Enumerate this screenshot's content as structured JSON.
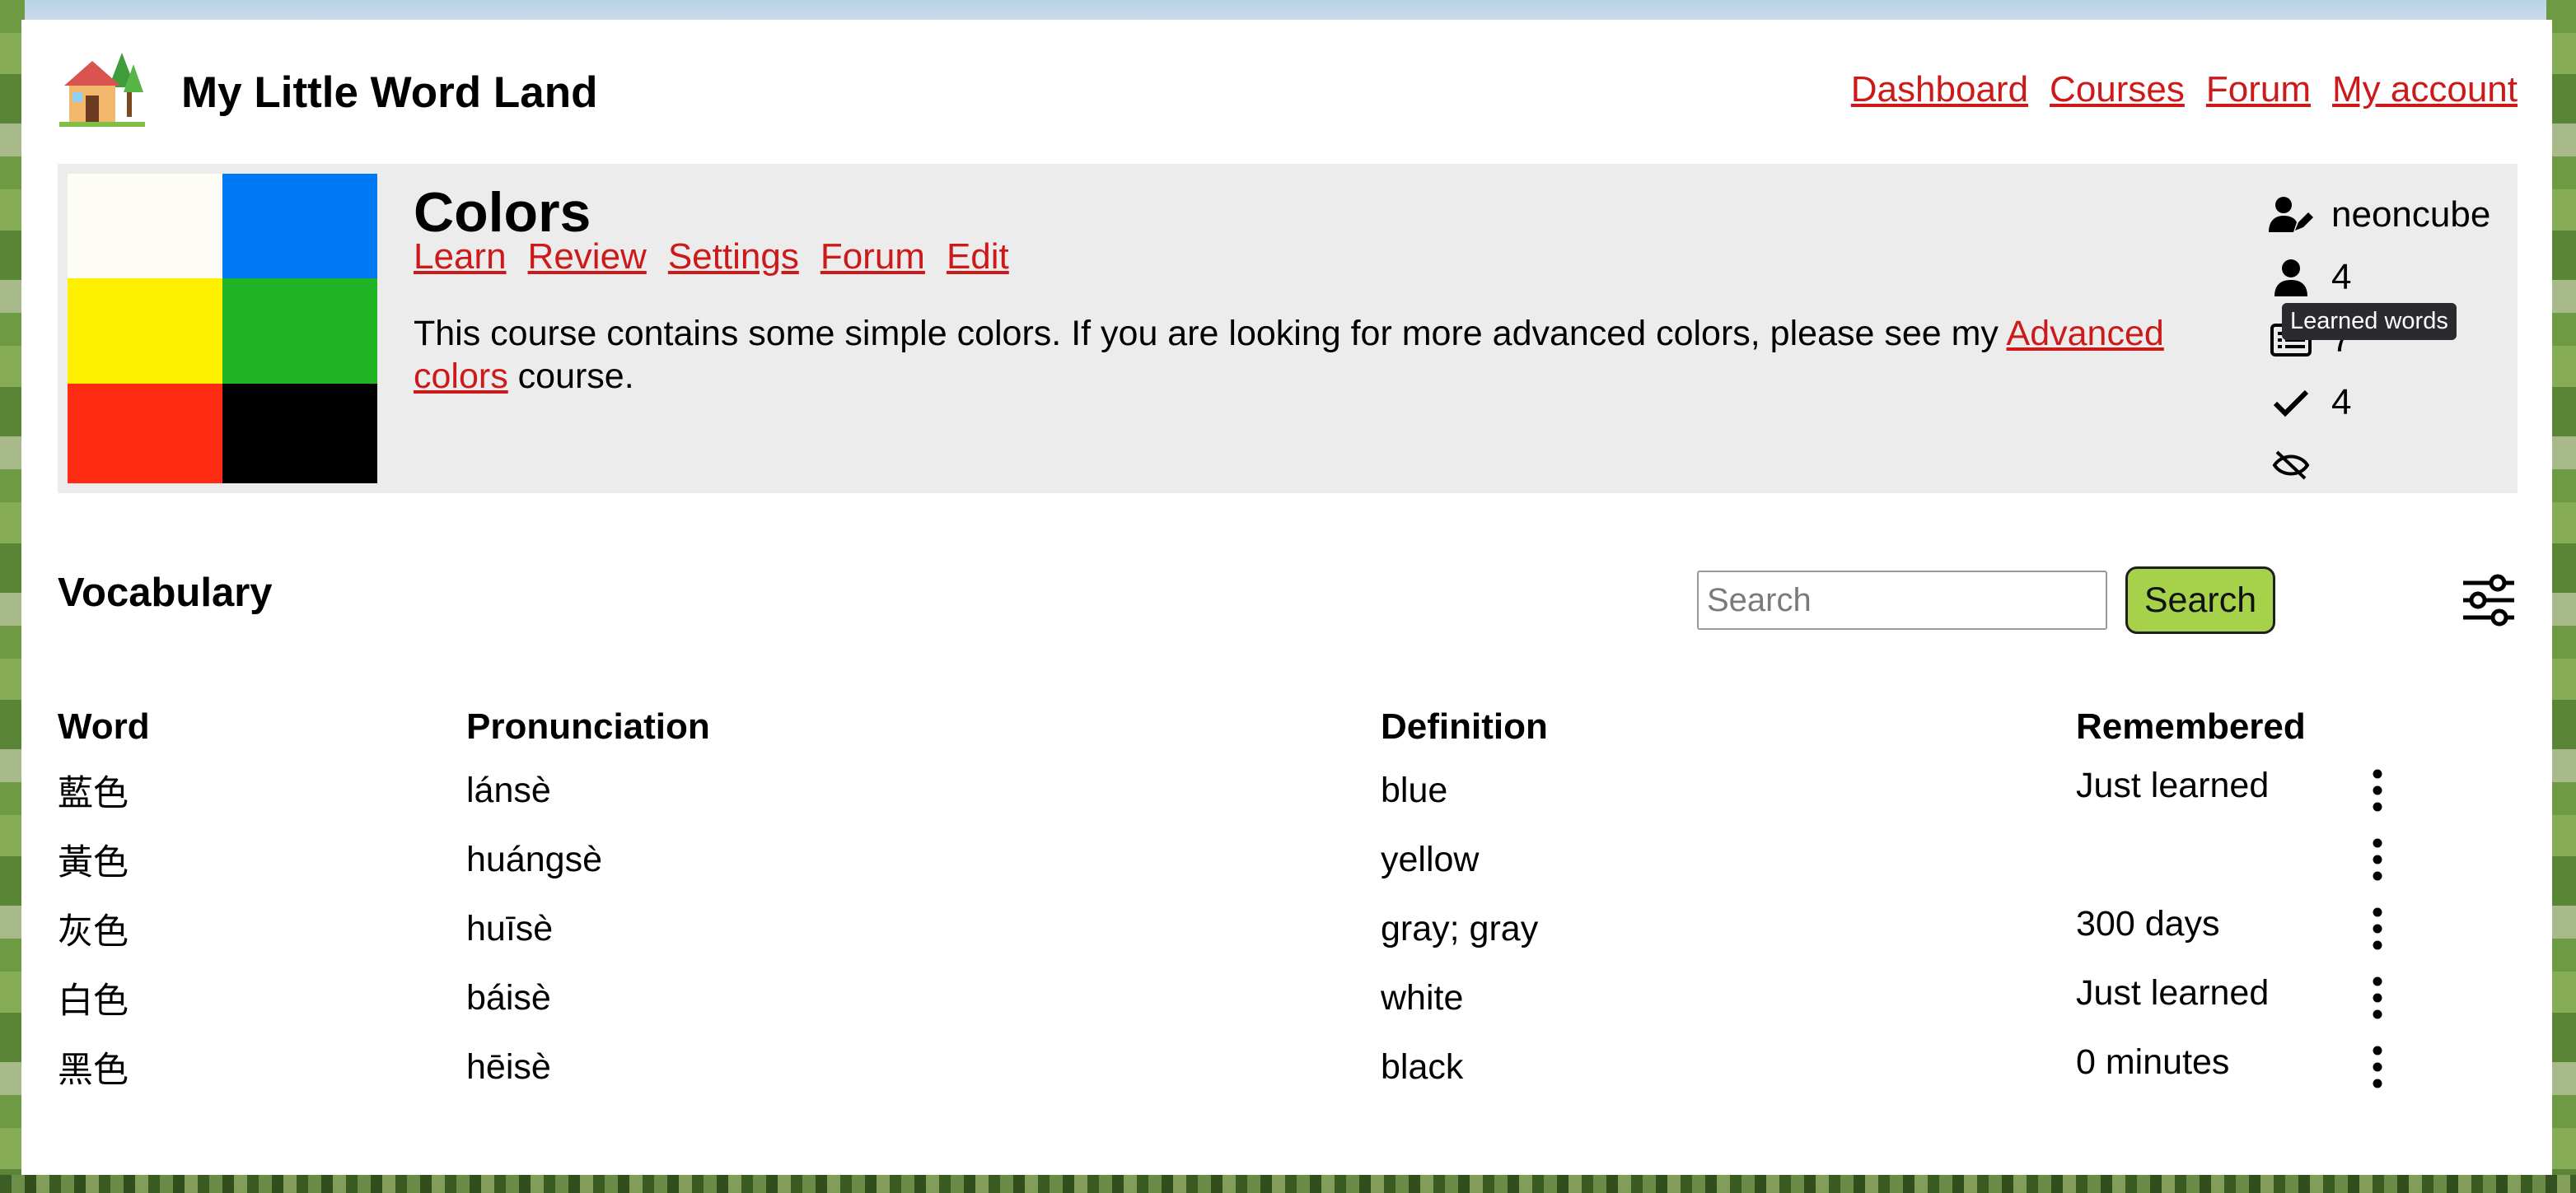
{
  "site": {
    "title": "My Little Word Land",
    "logo_icon": "house-with-trees-icon"
  },
  "nav": {
    "items": [
      "Dashboard",
      "Courses",
      "Forum",
      "My account"
    ]
  },
  "course": {
    "title": "Colors",
    "tabs": [
      "Learn",
      "Review",
      "Settings",
      "Forum",
      "Edit"
    ],
    "description_before": "This course contains some simple colors. If you are looking for more advanced colors, please see my ",
    "description_link": "Advanced colors",
    "description_after": " course.",
    "swatch_colors": [
      "#fdfdf6",
      "#0079f4",
      "#fff000",
      "#21b525",
      "#ff2b13",
      "#000000"
    ],
    "stats": [
      {
        "icon": "user-edit-icon",
        "value": "neoncube"
      },
      {
        "icon": "user-icon",
        "value": "4"
      },
      {
        "icon": "list-icon",
        "value": "7"
      },
      {
        "icon": "check-icon",
        "value": "4"
      },
      {
        "icon": "eye-slash-icon",
        "value": ""
      }
    ],
    "tooltip": "Learned words"
  },
  "vocabulary": {
    "title": "Vocabulary",
    "search_placeholder": "Search",
    "search_button": "Search",
    "columns": [
      "Word",
      "Pronunciation",
      "Definition",
      "Remembered"
    ],
    "rows": [
      {
        "word": "藍色",
        "pronunciation": "lánsè",
        "definition": "blue",
        "remembered": "Just learned"
      },
      {
        "word": "黃色",
        "pronunciation": "huángsè",
        "definition": "yellow",
        "remembered": ""
      },
      {
        "word": "灰色",
        "pronunciation": "huīsè",
        "definition": "gray; gray",
        "remembered": "300 days"
      },
      {
        "word": "白色",
        "pronunciation": "báisè",
        "definition": "white",
        "remembered": "Just learned"
      },
      {
        "word": "黑色",
        "pronunciation": "hēisè",
        "definition": "black",
        "remembered": "0 minutes"
      }
    ]
  },
  "colors": {
    "link": "#cc1a1a",
    "search_button": "#a6d14a",
    "panel": "#ececec",
    "tooltip_bg": "#2b2b2f"
  }
}
